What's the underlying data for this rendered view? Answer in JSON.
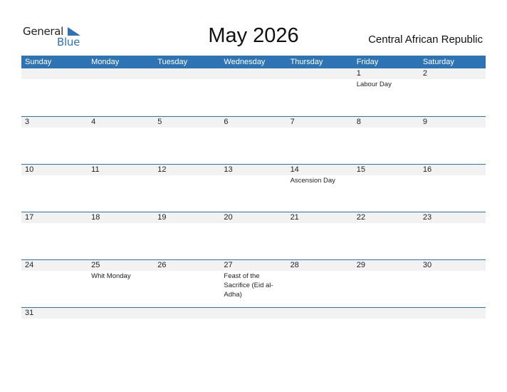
{
  "logo": {
    "word1": "General",
    "word2": "Blue"
  },
  "title": "May 2026",
  "country": "Central African Republic",
  "colors": {
    "accent": "#2e74b5",
    "strip": "#f2f2f2"
  },
  "weekdays": [
    "Sunday",
    "Monday",
    "Tuesday",
    "Wednesday",
    "Thursday",
    "Friday",
    "Saturday"
  ],
  "weeks": [
    [
      {
        "d": ""
      },
      {
        "d": ""
      },
      {
        "d": ""
      },
      {
        "d": ""
      },
      {
        "d": ""
      },
      {
        "d": "1",
        "e": "Labour Day"
      },
      {
        "d": "2"
      }
    ],
    [
      {
        "d": "3"
      },
      {
        "d": "4"
      },
      {
        "d": "5"
      },
      {
        "d": "6"
      },
      {
        "d": "7"
      },
      {
        "d": "8"
      },
      {
        "d": "9"
      }
    ],
    [
      {
        "d": "10"
      },
      {
        "d": "11"
      },
      {
        "d": "12"
      },
      {
        "d": "13"
      },
      {
        "d": "14",
        "e": "Ascension Day"
      },
      {
        "d": "15"
      },
      {
        "d": "16"
      }
    ],
    [
      {
        "d": "17"
      },
      {
        "d": "18"
      },
      {
        "d": "19"
      },
      {
        "d": "20"
      },
      {
        "d": "21"
      },
      {
        "d": "22"
      },
      {
        "d": "23"
      }
    ],
    [
      {
        "d": "24"
      },
      {
        "d": "25",
        "e": "Whit Monday"
      },
      {
        "d": "26"
      },
      {
        "d": "27",
        "e": "Feast of the Sacrifice (Eid al-Adha)"
      },
      {
        "d": "28"
      },
      {
        "d": "29"
      },
      {
        "d": "30"
      }
    ],
    [
      {
        "d": "31"
      },
      {
        "d": ""
      },
      {
        "d": ""
      },
      {
        "d": ""
      },
      {
        "d": ""
      },
      {
        "d": ""
      },
      {
        "d": ""
      }
    ]
  ]
}
